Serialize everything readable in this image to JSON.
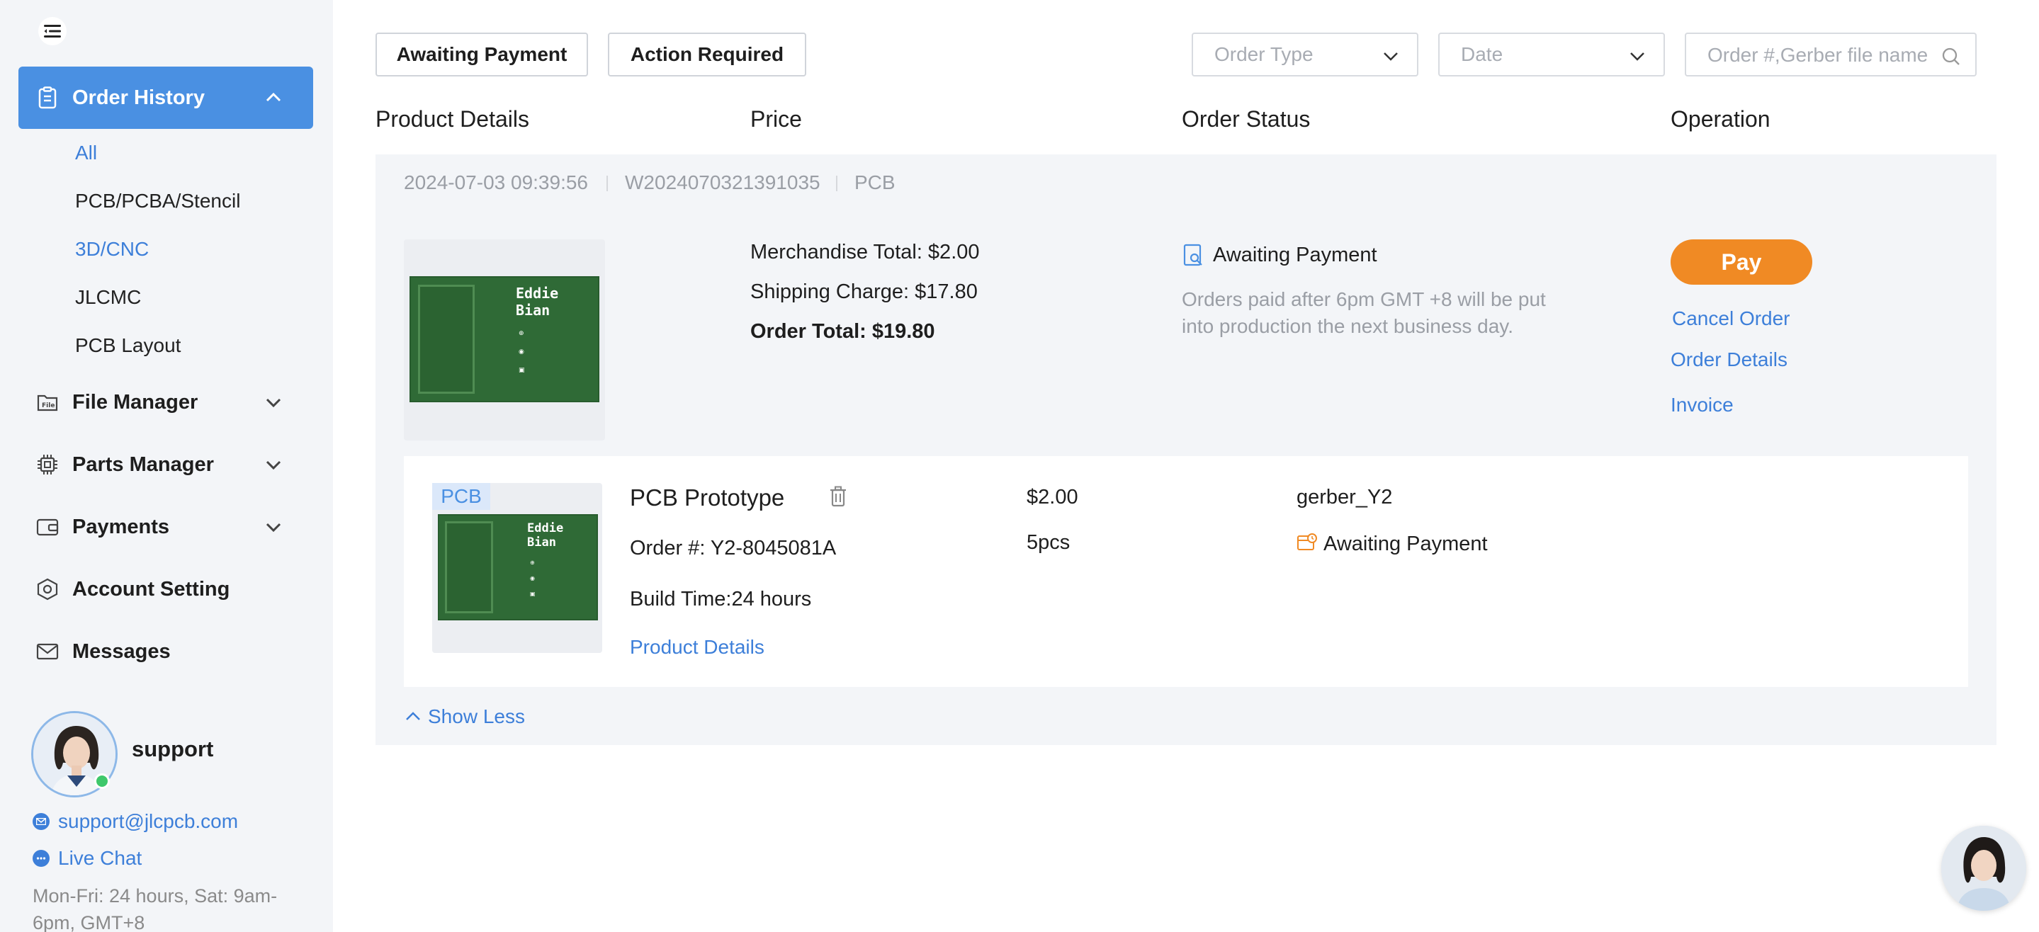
{
  "sidebar": {
    "order_history": "Order History",
    "sub_items": [
      "All",
      "PCB/PCBA/Stencil",
      "3D/CNC",
      "JLCMC",
      "PCB Layout"
    ],
    "file_manager": "File Manager",
    "parts_manager": "Parts Manager",
    "payments": "Payments",
    "account_setting": "Account Setting",
    "messages": "Messages",
    "user": {
      "name": "support",
      "email": "support@jlcpcb.com",
      "live_chat": "Live Chat",
      "hours": "Mon-Fri: 24 hours, Sat: 9am-6pm, GMT+8"
    }
  },
  "filters": {
    "awaiting_payment": "Awaiting Payment",
    "action_required": "Action Required",
    "order_type_placeholder": "Order Type",
    "date_placeholder": "Date",
    "search_placeholder": "Order #,Gerber file name"
  },
  "columns": [
    "Product Details",
    "Price",
    "Order Status",
    "Operation"
  ],
  "order": {
    "datetime": "2024-07-03 09:39:56",
    "order_id": "W2024070321391035",
    "category": "PCB",
    "board_label": "Eddie Bian",
    "merchandise_total": "Merchandise Total: $2.00",
    "shipping_charge": "Shipping Charge: $17.80",
    "order_total": "Order Total: $19.80",
    "status": "Awaiting Payment",
    "note": "Orders paid after 6pm GMT +8 will be put into production the next business day.",
    "pay": "Pay",
    "cancel": "Cancel Order",
    "details": "Order Details",
    "invoice": "Invoice",
    "item": {
      "tag": "PCB",
      "title": "PCB Prototype",
      "order_no": "Order #: Y2-8045081A",
      "build_time": "Build Time:24 hours",
      "product_details": "Product Details",
      "price": "$2.00",
      "qty": "5pcs",
      "file": "gerber_Y2",
      "status": "Awaiting Payment"
    },
    "show_less": "Show Less"
  },
  "colors": {
    "accent": "#4a90e2",
    "pay": "#f08a24",
    "link": "#3d7fd9",
    "online": "#3ec86b",
    "board": "#2f6a36"
  }
}
